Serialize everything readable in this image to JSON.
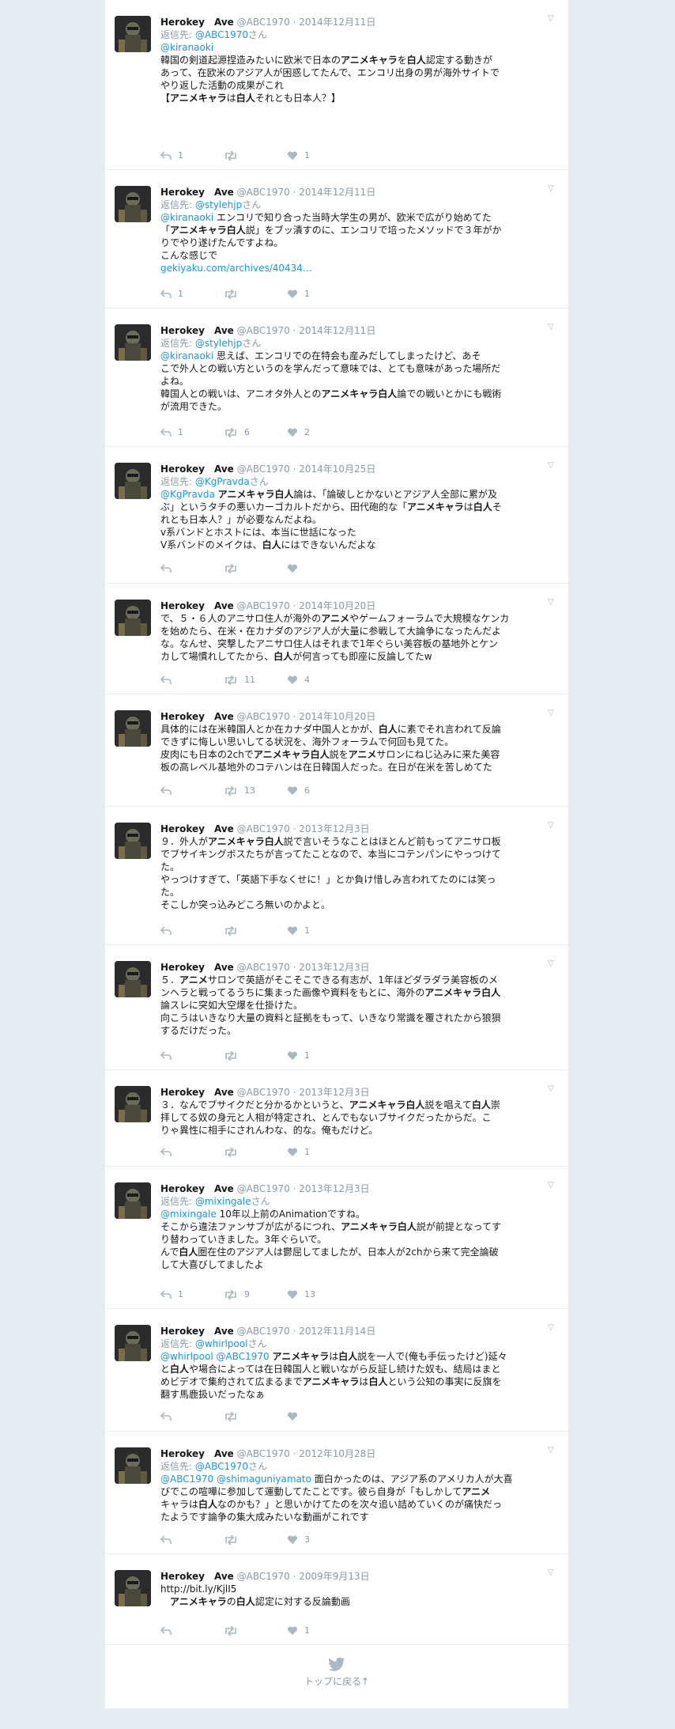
{
  "tweets": [
    {
      "name": "Herokey　Ave",
      "handle": "@ABC1970",
      "date": "2014年12月11日",
      "reply_prefix": "返信先: ",
      "reply_to": "@ABC1970",
      "reply_suffix": "さん",
      "mention": "@kiranaoki",
      "lines": [
        "韓国の剣道起源捏造みたいに欧米で日本のアニメキャラを白人認定する動きが",
        "あって、在欧米のアジア人が困惑してたんで、エンコリ出身の男が海外サイトで",
        "やり返した活動の成果がこれ",
        "【アニメキャラは白人それとも日本人？】"
      ],
      "replies": "1",
      "retweets": "",
      "likes": "1"
    },
    {
      "name": "Herokey　Ave",
      "handle": "@ABC1970",
      "date": "2014年12月11日",
      "reply_prefix": "返信先: ",
      "reply_to": "@stylehjp",
      "reply_suffix": "さん",
      "mention": "@kiranaoki",
      "lines": [
        "エンコリで知り合った当時大学生の男が、欧米で広がり始めてた",
        "「アニメキャラ白人説」をブッ潰すのに、エンコリで培ったメソッドで３年がか",
        "りでやり遂げたんですよね。",
        "こんな感じで"
      ],
      "url": "gekiyaku.com/archives/40434…",
      "replies": "1",
      "retweets": "",
      "likes": "1"
    },
    {
      "name": "Herokey　Ave",
      "handle": "@ABC1970",
      "date": "2014年12月11日",
      "reply_prefix": "返信先: ",
      "reply_to": "@stylehjp",
      "reply_suffix": "さん",
      "mention": "@kiranaoki",
      "lines": [
        "思えば、エンコリでの在特会も産みだしてしまったけど、あそ",
        "こで外人との戦い方というのを学んだって意味では、とても意味があった場所だ",
        "よね。",
        "韓国人との戦いは、アニオタ外人とのアニメキャラ白人論での戦いとかにも戦術",
        "が流用できた。"
      ],
      "replies": "1",
      "retweets": "6",
      "likes": "2"
    },
    {
      "name": "Herokey　Ave",
      "handle": "@ABC1970",
      "date": "2014年10月25日",
      "reply_prefix": "返信先: ",
      "reply_to": "@KgPravda",
      "reply_suffix": "さん",
      "mention": "@KgPravda",
      "lines": [
        "アニメキャラ白人論は、「論破しとかないとアジア人全部に累が及",
        "ぶ」というタチの悪いカーゴカルトだから、田代砲的な「アニメキャラは白人そ",
        "れとも日本人？」が必要なんだよね。",
        "v系バンドとホストには、本当に世話になった",
        "V系バンドのメイクは、白人にはできないんだよな"
      ],
      "replies": "",
      "retweets": "",
      "likes": ""
    },
    {
      "name": "Herokey　Ave",
      "handle": "@ABC1970",
      "date": "2014年10月20日",
      "lines": [
        "で、５・６人のアニサロ住人が海外のアニメやゲームフォーラムで大規模なケンカ",
        "を始めたら、在米・在カナダのアジア人が大量に参戦して大論争になったんだよ",
        "な。なんせ、突撃したアニサロ住人はそれまで1年ぐらい美容板の基地外とケン",
        "カして場慣れしてたから、白人が何言っても即座に反論してたw"
      ],
      "replies": "",
      "retweets": "11",
      "likes": "4"
    },
    {
      "name": "Herokey　Ave",
      "handle": "@ABC1970",
      "date": "2014年10月20日",
      "lines": [
        "具体的には在米韓国人とか在カナダ中国人とかが、白人に素でそれ言われて反論",
        "できずに悔しい思いしてる状況を、海外フォーラムで何回も見てた。",
        "皮肉にも日本の2chでアニメキャラ白人説をアニメサロンにねじ込みに来た美容",
        "板の高レベル基地外のコテハンは在日韓国人だった。在日が在米を苦しめてた"
      ],
      "replies": "",
      "retweets": "13",
      "likes": "6"
    },
    {
      "name": "Herokey　Ave",
      "handle": "@ABC1970",
      "date": "2013年12月3日",
      "lines": [
        "９．外人がアニメキャラ白人説で言いそうなことはほとんど前もってアニサロ板",
        "でブサイキングボスたちが言ってたことなので、本当にコテンパンにやっつけて",
        "た。",
        "やっつけすぎて、「英語下手なくせに！」とか負け惜しみ言われてたのには笑っ",
        "た。",
        "そこしか突っ込みどころ無いのかよと。"
      ],
      "replies": "",
      "retweets": "",
      "likes": "1"
    },
    {
      "name": "Herokey　Ave",
      "handle": "@ABC1970",
      "date": "2013年12月3日",
      "lines": [
        "５．アニメサロンで英語がそこそこできる有志が、1年ほどダラダラ美容板のメ",
        "ンヘラと戦ってるうちに集まった画像や資料をもとに、海外のアニメキャラ白人",
        "論スレに突如大空爆を仕掛けた。",
        "向こうはいきなり大量の資料と証拠をもって、いきなり常識を覆されたから狼狽",
        "するだけだった。"
      ],
      "replies": "",
      "retweets": "",
      "likes": "1"
    },
    {
      "name": "Herokey　Ave",
      "handle": "@ABC1970",
      "date": "2013年12月3日",
      "lines": [
        "３．なんでブサイクだと分かるかというと、アニメキャラ白人説を唱えて白人崇",
        "拝してる奴の身元と人相が特定され、とんでもないブサイクだったからだ。こ",
        "りゃ異性に相手にされんわな、的な。俺もだけど。"
      ],
      "replies": "",
      "retweets": "",
      "likes": "1"
    },
    {
      "name": "Herokey　Ave",
      "handle": "@ABC1970",
      "date": "2013年12月3日",
      "reply_prefix": "返信先: ",
      "reply_to": "@mixingale",
      "reply_suffix": "さん",
      "mention": "@mixingale",
      "lines": [
        "10年以上前のAnimationですね。",
        "そこから違法ファンサブが広がるにつれ、アニメキャラ白人説が前提となってす",
        "り替わっていきました。3年ぐらいで。",
        "んで白人圏在住のアジア人は鬱屈してましたが、日本人が2chから来て完全論破",
        "して大喜びしてましたよ"
      ],
      "replies": "1",
      "retweets": "9",
      "likes": "13"
    },
    {
      "name": "Herokey　Ave",
      "handle": "@ABC1970",
      "date": "2012年11月14日",
      "reply_prefix": "返信先: ",
      "reply_to": "@whirlpool",
      "reply_suffix": "さん",
      "mention": "@whirlpool @ABC1970",
      "lines": [
        "アニメキャラは白人説を一人で(俺も手伝ったけど)延々",
        "と白人や場合によっては在日韓国人と戦いながら反証し続けた奴も、結局はまと",
        "めビデオで集約されて広まるまでアニメキャラは白人という公知の事実に反旗を",
        "翻す馬鹿扱いだったなぁ"
      ],
      "replies": "",
      "retweets": "",
      "likes": ""
    },
    {
      "name": "Herokey　Ave",
      "handle": "@ABC1970",
      "date": "2012年10月28日",
      "reply_prefix": "返信先: ",
      "reply_to": "@ABC1970",
      "reply_suffix": "さん",
      "mention": "@ABC1970 @shimaguniyamato",
      "lines": [
        "面白かったのは、アジア系のアメリカ人が大喜",
        "びでこの喧嘩に参加して運動してたことです。彼ら自身が「もしかしてアニメ",
        "キャラは白人なのかも？」と思いかけてたのを次々追い詰めていくのが痛快だっ",
        "たようです論争の集大成みたいな動画がこれです"
      ],
      "replies": "",
      "retweets": "",
      "likes": "3"
    },
    {
      "name": "Herokey　Ave",
      "handle": "@ABC1970",
      "date": "2009年9月13日",
      "lines": [
        "http://bit.ly/KjlI5",
        "　アニメキャラの白人認定に対する反論動画"
      ],
      "replies": "",
      "retweets": "",
      "likes": "1"
    }
  ],
  "footer": {
    "back_to_top": "トップに戻る↑"
  },
  "colors": {
    "link": "#1b95e0",
    "muted": "#8899a6",
    "page_bg": "#e6ecf0"
  }
}
